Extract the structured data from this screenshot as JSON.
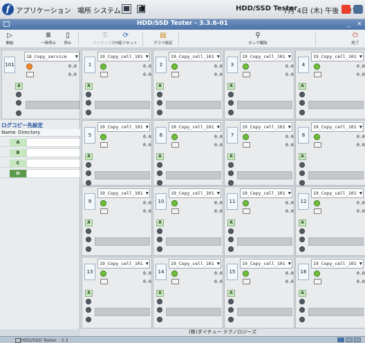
{
  "top_panel": {
    "menus": [
      "アプリケーション",
      "場所",
      "システム"
    ],
    "title": "HDD/SSD Tester",
    "clock": "7月 4日 (木) 午後 1:27"
  },
  "window": {
    "title": "HDD/SSD Tester - 3.3.6-01"
  },
  "toolbar": {
    "start": "開始",
    "pause": "一時停止",
    "stop": "停止",
    "license": "ライセンス更新",
    "reset": "一括リセット",
    "graph": "グラフ設定",
    "unlock": "ロック解除",
    "exit": "終了"
  },
  "cell101": {
    "number": "101",
    "service": "18_Copy_service",
    "value1": "0.0",
    "value2": "0.0",
    "slot": "A"
  },
  "logcopy": {
    "title": "ログコピー先設定",
    "col_name": "Name",
    "col_dir": "Directory",
    "rows": [
      "A",
      "B",
      "C",
      "D"
    ]
  },
  "grid": {
    "label": "19_Copy_cell_101",
    "value": "0.0",
    "slot": "A",
    "cells": [
      "1",
      "2",
      "3",
      "4",
      "5",
      "6",
      "7",
      "8",
      "9",
      "10",
      "11",
      "12",
      "13",
      "14",
      "15",
      "16"
    ]
  },
  "footer": "(株)ダイチュー テクノロジーズ",
  "bottom_panel": {
    "window_label": "HDD/SSD Tester - 3.3"
  },
  "colors": {
    "led_green": "#6fbf3a",
    "led_orange": "#f08a2c",
    "titlebar": "#4c73a8",
    "slot_green": "#cbe8c3"
  }
}
